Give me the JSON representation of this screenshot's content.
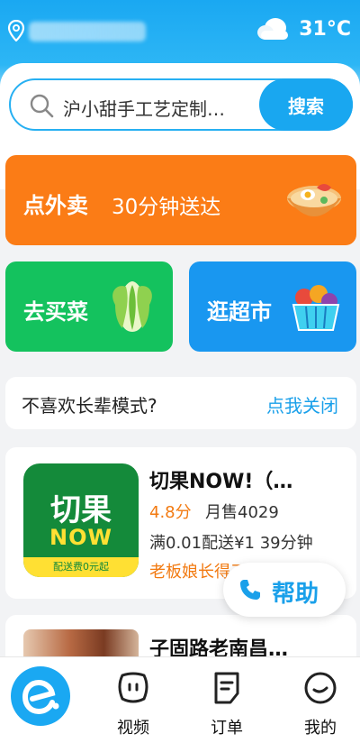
{
  "header": {
    "location_icon": "location-pin-icon",
    "weather_icon": "cloud-icon",
    "temperature": "31°C"
  },
  "search": {
    "placeholder_text": "沪小甜手工艺定制…",
    "button_label": "搜索"
  },
  "banners": {
    "takeout": {
      "title": "点外卖",
      "subtitle": "30分钟送达",
      "icon": "bowl-icon"
    },
    "groceries": {
      "title": "去买菜",
      "icon": "cabbage-icon"
    },
    "supermarket": {
      "title": "逛超市",
      "icon": "basket-icon"
    }
  },
  "elder_mode": {
    "question": "不喜欢长辈模式?",
    "action": "点我关闭"
  },
  "shops": [
    {
      "name": "切果NOW!（…",
      "logo_line1": "切果",
      "logo_line2": "NOW",
      "logo_strip": "配送费0元起",
      "rating": "4.8分",
      "sales": "月售4029",
      "delivery": "满0.01配送¥1  39分钟",
      "tag": "老板娘长得三河市"
    },
    {
      "name": "子固路老南昌…"
    }
  ],
  "help": {
    "label": "帮助",
    "icon": "phone-icon"
  },
  "nav": {
    "home_icon": "eleme-logo-icon",
    "items": [
      {
        "label": "视频",
        "icon": "video-face-icon"
      },
      {
        "label": "订单",
        "icon": "order-note-icon"
      },
      {
        "label": "我的",
        "icon": "profile-face-icon"
      }
    ]
  },
  "colors": {
    "brand_blue": "#1aa8f2",
    "takeout_orange": "#fb7c16",
    "grocery_green": "#14c25e",
    "market_blue": "#1997f0",
    "rating_orange": "#f27a11"
  }
}
